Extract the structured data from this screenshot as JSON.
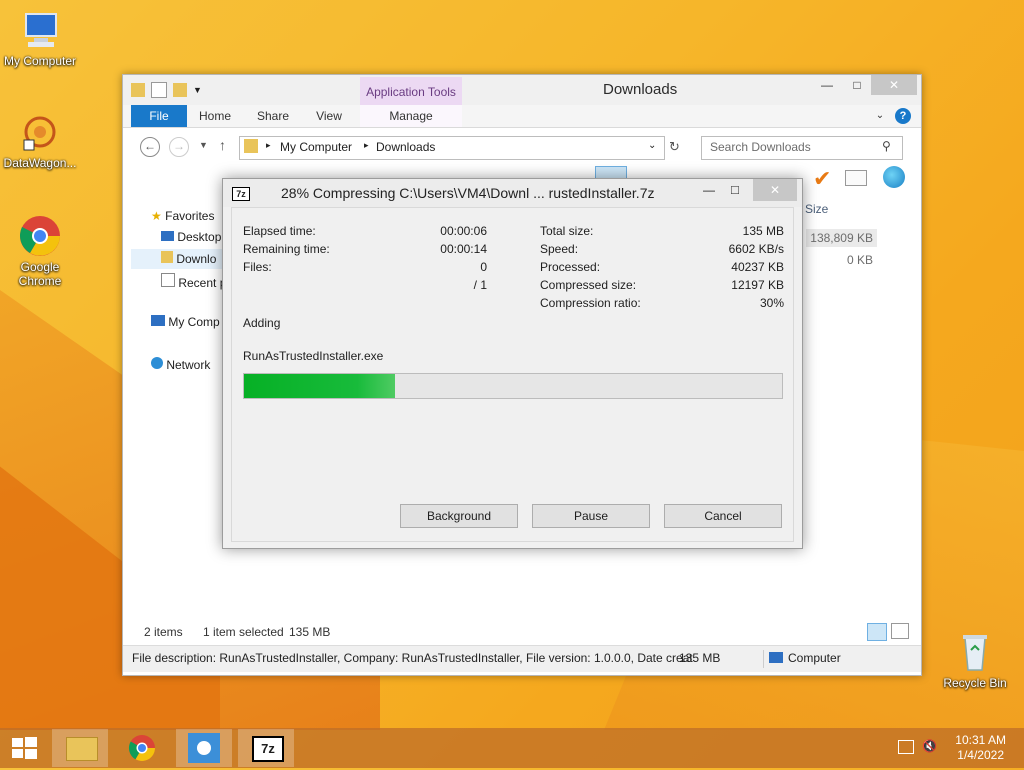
{
  "desktop": {
    "icons": [
      {
        "label": "My Computer"
      },
      {
        "label": "DataWagon..."
      },
      {
        "label": "Google Chrome"
      },
      {
        "label": "Recycle Bin"
      }
    ]
  },
  "explorer": {
    "title": "Downloads",
    "app_tools": "Application Tools",
    "tabs": {
      "file": "File",
      "home": "Home",
      "share": "Share",
      "view": "View",
      "manage": "Manage"
    },
    "breadcrumb": [
      "My Computer",
      "Downloads"
    ],
    "search_placeholder": "Search Downloads",
    "nav": {
      "favorites": "Favorites",
      "desktop": "Desktop",
      "downloads": "Downlo",
      "recent": "Recent p",
      "my_computer": "My Comp",
      "network": "Network"
    },
    "column_size": "Size",
    "sizes": [
      "138,809 KB",
      "0 KB"
    ],
    "status": {
      "items": "2 items",
      "selected": "1 item selected",
      "selected_size": "135 MB"
    },
    "detail": {
      "description": "File description: RunAsTrustedInstaller, Company: RunAsTrustedInstaller, File version: 1.0.0.0, Date creat",
      "size": "135 MB",
      "location": "Computer"
    }
  },
  "dialog": {
    "title": "28% Compressing C:\\Users\\VM4\\Downl ... rustedInstaller.7z",
    "left_stats": {
      "elapsed_label": "Elapsed time:",
      "elapsed": "00:00:06",
      "remaining_label": "Remaining time:",
      "remaining": "00:00:14",
      "files_label": "Files:",
      "files": "0",
      "files_total": "/ 1"
    },
    "right_stats": {
      "total_label": "Total size:",
      "total": "135 MB",
      "speed_label": "Speed:",
      "speed": "6602 KB/s",
      "processed_label": "Processed:",
      "processed": "40237 KB",
      "compressed_label": "Compressed size:",
      "compressed": "12197 KB",
      "ratio_label": "Compression ratio:",
      "ratio": "30%"
    },
    "action": "Adding",
    "current_file": "RunAsTrustedInstaller.exe",
    "progress_percent": 28,
    "buttons": {
      "background": "Background",
      "pause": "Pause",
      "cancel": "Cancel"
    }
  },
  "taskbar": {
    "clock_time": "10:31 AM",
    "clock_date": "1/4/2022"
  }
}
